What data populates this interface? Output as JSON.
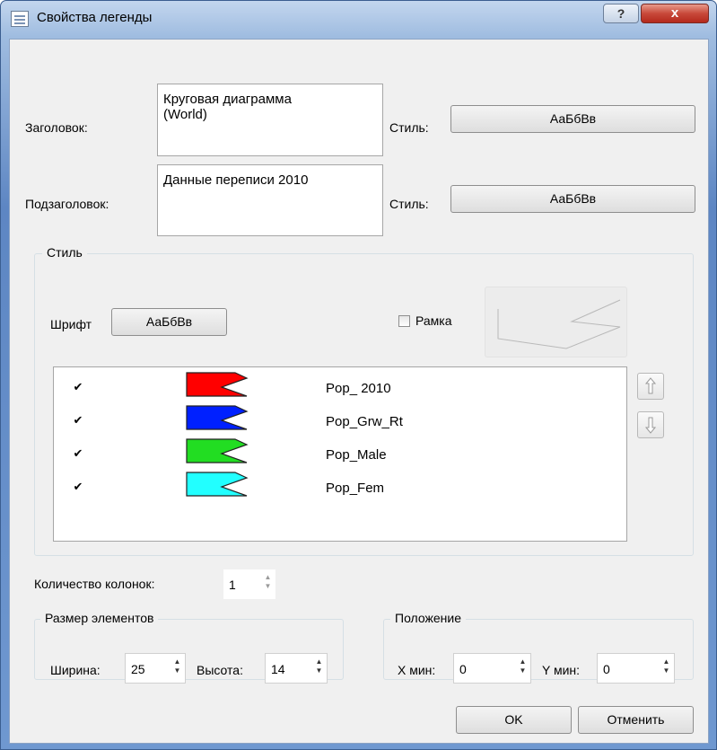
{
  "window": {
    "title": "Свойства легенды",
    "help_label": "?",
    "close_label": "x"
  },
  "title_row": {
    "label": "Заголовок:",
    "value": "Круговая диаграмма\n(World)",
    "style_label": "Стиль:",
    "style_button": "АаБбВв"
  },
  "subtitle_row": {
    "label": "Подзаголовок:",
    "value": "Данные переписи 2010",
    "style_label": "Стиль:",
    "style_button": "АаБбВв"
  },
  "style_group": {
    "title": "Стиль",
    "font_label": "Шрифт",
    "font_button": "АаБбВв",
    "frame_label": "Рамка",
    "frame_checked": false
  },
  "legend_items": [
    {
      "checked": true,
      "mark": "✔",
      "name": "Pop_ 2010",
      "color": "#ff0000"
    },
    {
      "checked": true,
      "mark": "✔",
      "name": "Pop_Grw_Rt",
      "color": "#0020ff"
    },
    {
      "checked": true,
      "mark": "✔",
      "name": "Pop_Male",
      "color": "#22dd22"
    },
    {
      "checked": true,
      "mark": "✔",
      "name": "Pop_Fem",
      "color": "#22ffff"
    }
  ],
  "columns": {
    "label": "Количество колонок:",
    "value": "1"
  },
  "size_group": {
    "title": "Размер элементов",
    "width_label": "Ширина:",
    "width_value": "25",
    "height_label": "Высота:",
    "height_value": "14"
  },
  "position_group": {
    "title": "Положение",
    "xmin_label": "X мин:",
    "xmin_value": "0",
    "ymin_label": "Y мин:",
    "ymin_value": "0"
  },
  "buttons": {
    "ok": "OK",
    "cancel": "Отменить"
  }
}
